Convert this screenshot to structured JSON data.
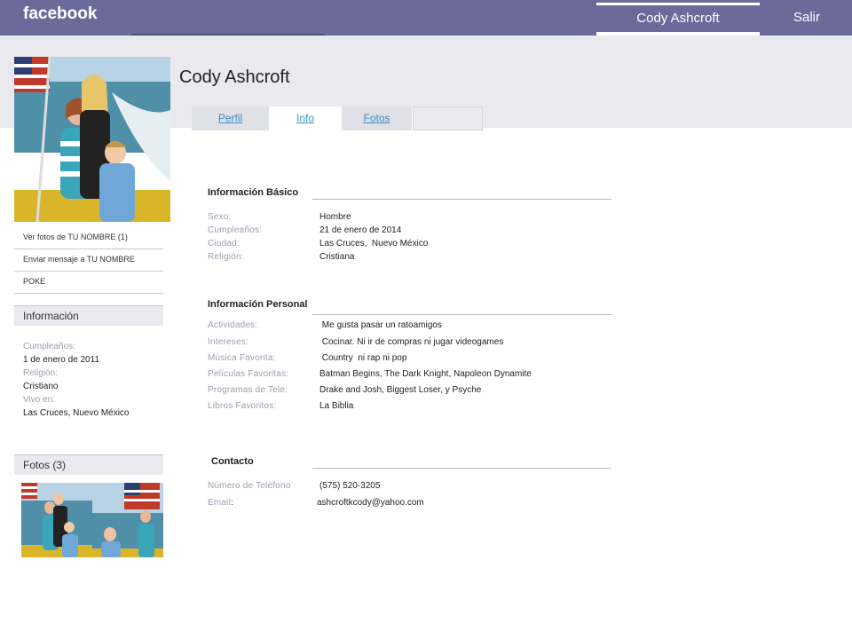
{
  "topbar": {
    "logo": "facebook",
    "user_link": "Cody Ashcroft",
    "logout": "Salir"
  },
  "profile": {
    "name": "Cody Ashcroft"
  },
  "tabs": [
    {
      "label": "Perfil"
    },
    {
      "label": "Info"
    },
    {
      "label": "Fotos"
    },
    {
      "label": ""
    }
  ],
  "sidebar": {
    "links": [
      {
        "label": "Ver fotos de TU NOMBRE (1)"
      },
      {
        "label": "Enviar mensaje a TU NOMBRE"
      },
      {
        "label": "POKE"
      }
    ],
    "info_heading": "Información",
    "info": {
      "birthday_label": "Cumpleaños:",
      "birthday_value": "1 de enero de 2011",
      "religion_label": "Religión:",
      "religion_value": "Cristiano",
      "lives_label": "Vivo en:",
      "lives_value": "Las Cruces, Nuevo México"
    },
    "photos_heading": "Fotos (3)"
  },
  "basic": {
    "title": "Información Básico",
    "rows": [
      {
        "label": "Sexo:",
        "value": "Hombre"
      },
      {
        "label": "Cumpleaños:",
        "value": "21 de enero de 2014"
      },
      {
        "label": "Ciudad:",
        "value": "Las Cruces,  Nuevo México"
      },
      {
        "label": "Religión:",
        "value": "Cristiana"
      }
    ]
  },
  "personal": {
    "title": "Información Personal",
    "rows": [
      {
        "label": "Actividades:",
        "value": " Me gusta pasar un ratoamigos"
      },
      {
        "label": "Intereses:",
        "value": " Cocinar. Ni ir de compras ni jugar videogames"
      },
      {
        "label": "Música Favorita:",
        "value": " Country  ni rap ni pop"
      },
      {
        "label": "Películas Favoritas:",
        "value": "Batman Begins, The Dark Knight, Napoleon Dynamite"
      },
      {
        "label": "Programas de Tele:",
        "value": "Drake and Josh, Biggest Loser, y Psyche"
      },
      {
        "label": "Libros Favoritos:",
        "value": "La Biblia"
      }
    ]
  },
  "contact": {
    "title": "Contacto",
    "phone_label": "Número de Teléfono",
    "phone_value": "(575) 520-3205",
    "email_label": "Email",
    "email_suffix": ":",
    "email_value": "ashcroftkcody@yahoo.com"
  },
  "colors": {
    "topbar": "#6b6b9b",
    "link": "#3b8fc4",
    "label": "#9aa0ad"
  }
}
